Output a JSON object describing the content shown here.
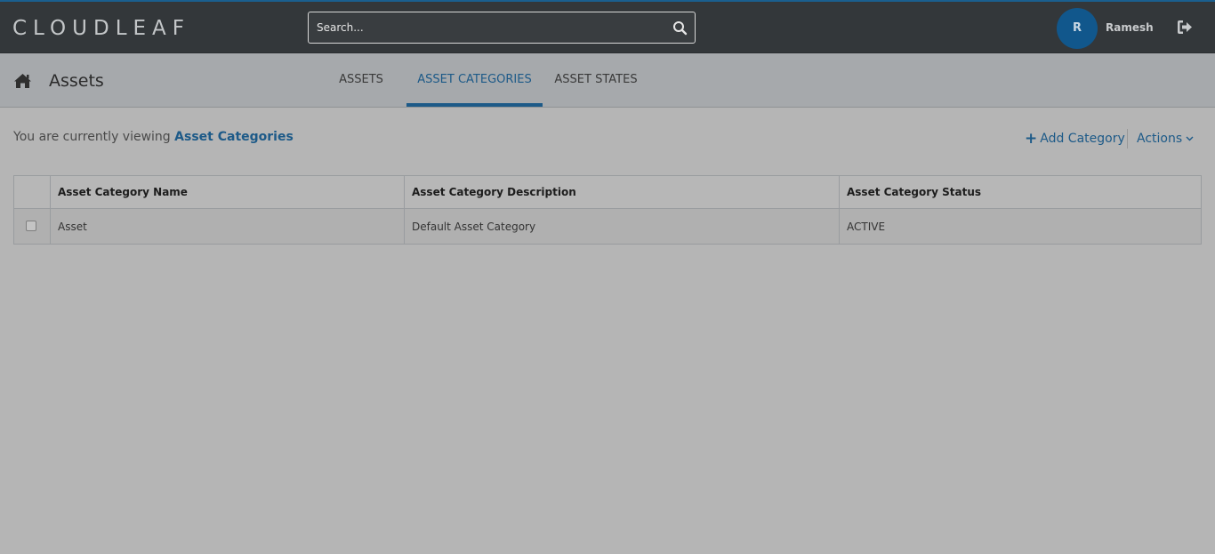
{
  "header": {
    "logo": "CLOUDLEAF",
    "search_placeholder": "Search...",
    "user_initial": "R",
    "user_name": "Ramesh"
  },
  "subnav": {
    "title": "Assets",
    "tabs": [
      {
        "label": "ASSETS",
        "active": false
      },
      {
        "label": "ASSET CATEGORIES",
        "active": true
      },
      {
        "label": "ASSET STATES",
        "active": false
      }
    ]
  },
  "viewing": {
    "prefix": "You are currently viewing",
    "highlight": "Asset Categories"
  },
  "toolbar": {
    "add_label": "Add Category",
    "actions_label": "Actions"
  },
  "table": {
    "columns": [
      "Asset Category Name",
      "Asset Category Description",
      "Asset Category Status"
    ],
    "rows": [
      {
        "name": "Asset",
        "description": "Default Asset Category",
        "status": "ACTIVE"
      }
    ]
  },
  "colors": {
    "accent": "#1d5a88",
    "topbar": "#33373a",
    "subnav": "#a6a9ac",
    "background": "#b5b5b5"
  }
}
